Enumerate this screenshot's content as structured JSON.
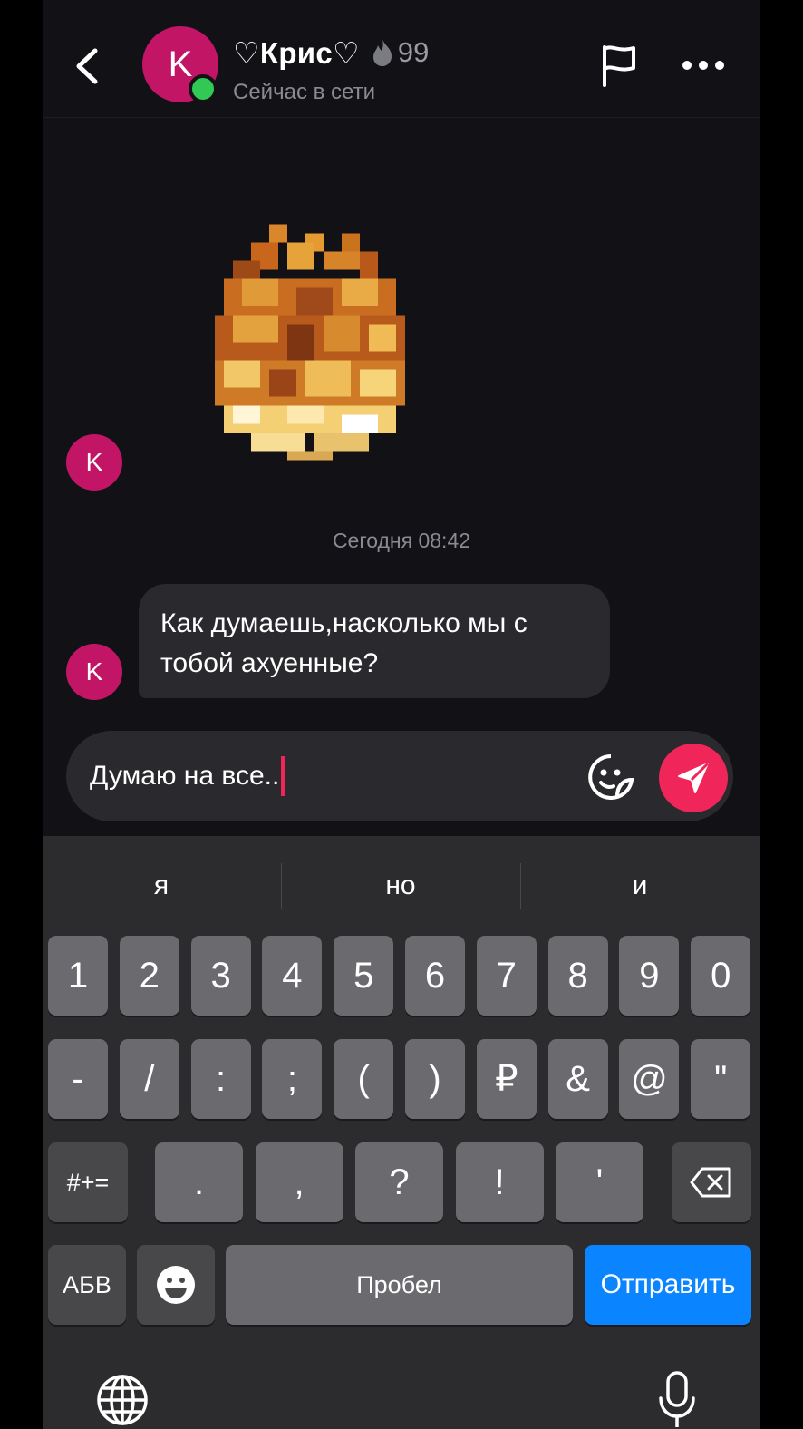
{
  "header": {
    "avatar_letter": "K",
    "name": "♡Крис♡",
    "streak": "99",
    "status": "Сейчас в сети",
    "online_color": "#31c853"
  },
  "chat": {
    "sticker": "fire-sticker",
    "sender_avatar_letter": "K",
    "date": "Сегодня 08:42",
    "message": {
      "line1": "Как думаешь,насколько мы с",
      "line2": "тобой ахуенные?"
    }
  },
  "composer": {
    "value": "Думаю на все..",
    "accent_color": "#f0265a"
  },
  "keyboard": {
    "suggestions": [
      "я",
      "но",
      "и"
    ],
    "row1": [
      "1",
      "2",
      "3",
      "4",
      "5",
      "6",
      "7",
      "8",
      "9",
      "0"
    ],
    "row2": [
      "-",
      "/",
      ":",
      ";",
      "(",
      ")",
      "₽",
      "&",
      "@",
      "\""
    ],
    "row3": {
      "symbols": "#+=",
      "keys": [
        ".",
        ",",
        "?",
        "!",
        "'"
      ],
      "backspace": "backspace-icon"
    },
    "row4": {
      "alphabet": "АБВ",
      "emoji": "emoji-icon",
      "space": "Пробел",
      "send": "Отправить"
    },
    "send_color": "#0a84ff"
  }
}
